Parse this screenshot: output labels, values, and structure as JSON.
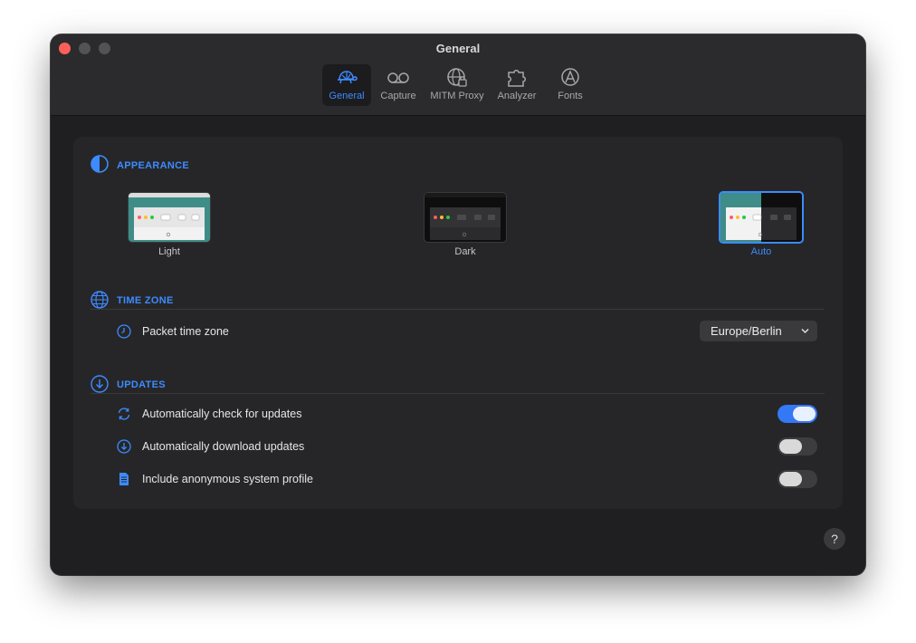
{
  "window": {
    "title": "General"
  },
  "toolbar": {
    "tabs": [
      {
        "label": "General",
        "icon": "turtle-icon",
        "active": true
      },
      {
        "label": "Capture",
        "icon": "voicemail-icon",
        "active": false
      },
      {
        "label": "MITM Proxy",
        "icon": "globe-lock-icon",
        "active": false
      },
      {
        "label": "Analyzer",
        "icon": "puzzle-icon",
        "active": false
      },
      {
        "label": "Fonts",
        "icon": "font-globe-icon",
        "active": false
      }
    ]
  },
  "appearance": {
    "title": "APPEARANCE",
    "icon": "half-circle-icon",
    "options": [
      {
        "label": "Light",
        "selected": false
      },
      {
        "label": "Dark",
        "selected": false
      },
      {
        "label": "Auto",
        "selected": true
      }
    ]
  },
  "time_zone": {
    "title": "TIME ZONE",
    "icon": "globe-icon",
    "packet_label": "Packet time zone",
    "value": "Europe/Berlin"
  },
  "updates": {
    "title": "UPDATES",
    "icon": "download-circle-icon",
    "items": [
      {
        "label": "Automatically check for updates",
        "icon": "refresh-icon",
        "enabled": true
      },
      {
        "label": "Automatically download updates",
        "icon": "download-icon",
        "enabled": false
      },
      {
        "label": "Include anonymous system profile",
        "icon": "document-icon",
        "enabled": false
      }
    ]
  },
  "help": {
    "label": "?"
  },
  "colors": {
    "accent": "#3d8bff",
    "window": "#1f1f21",
    "panel": "#262628"
  }
}
